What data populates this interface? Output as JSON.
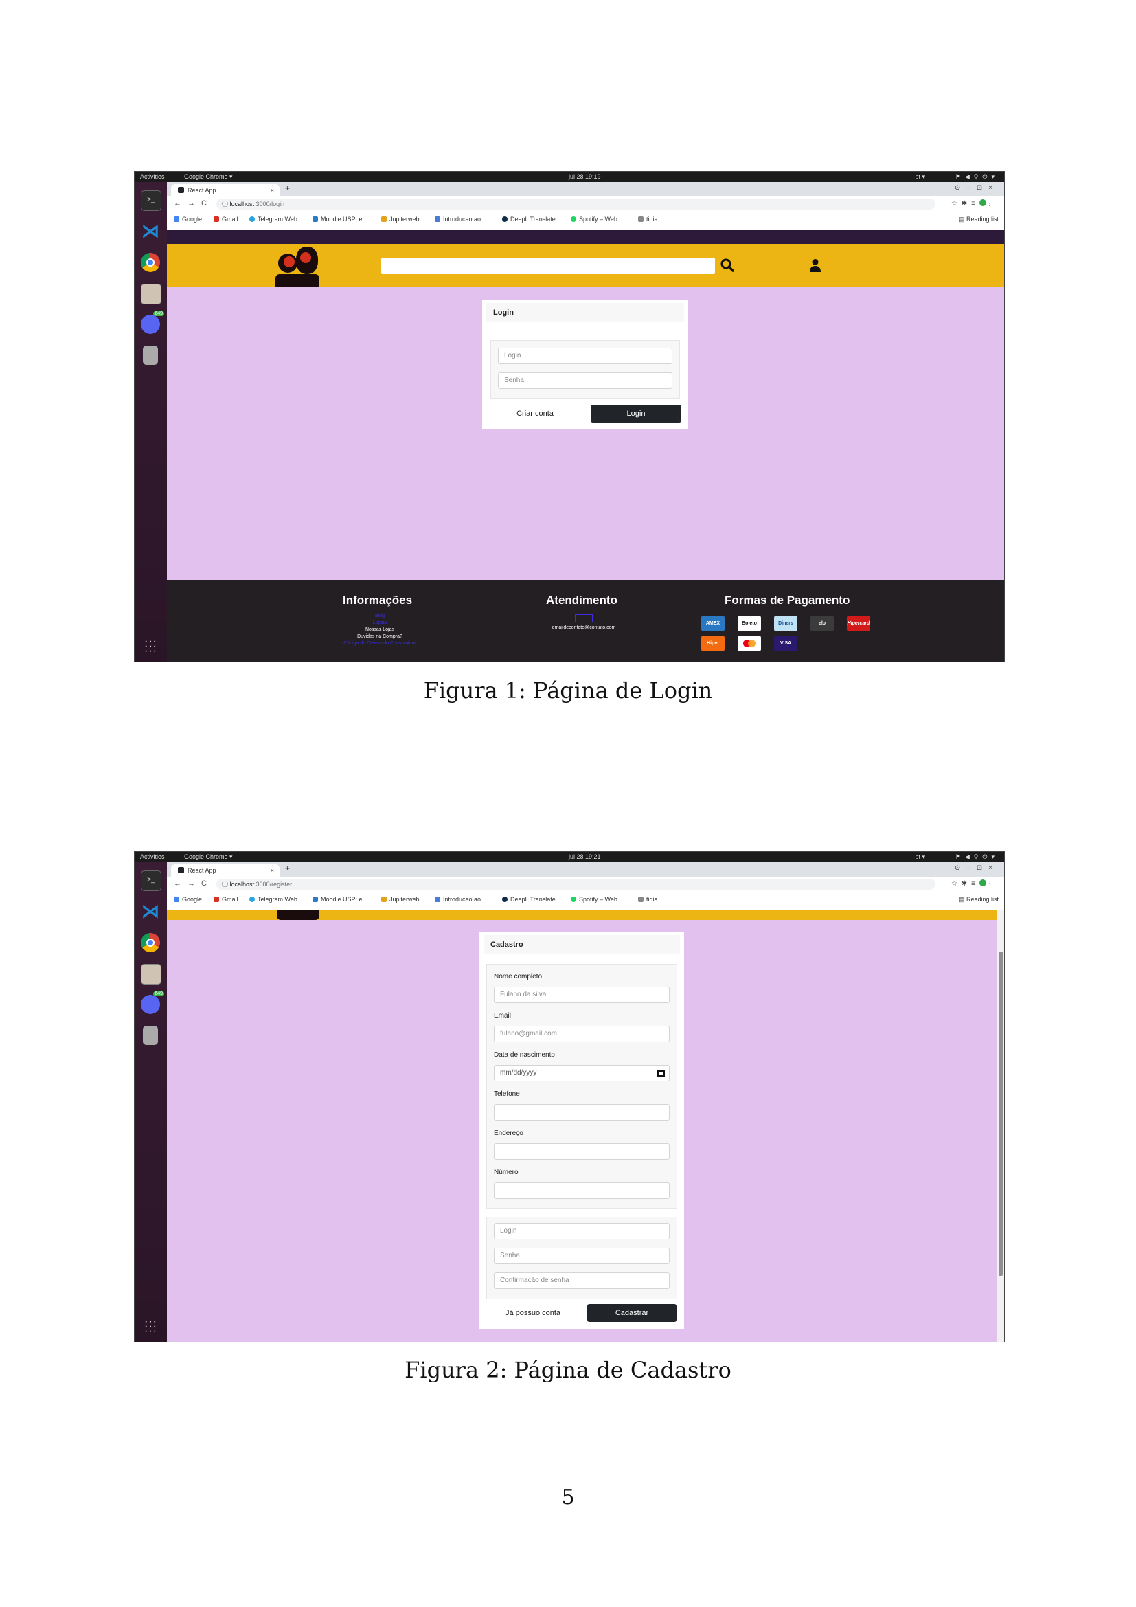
{
  "figure1": {
    "ubuntu": {
      "activities": "Activities",
      "app": "Google Chrome ▾",
      "clock": "jul 28  19:19",
      "lang": "pt ▾",
      "badge": "649"
    },
    "browser": {
      "tab_title": "React App",
      "url_host": "localhost",
      "url_path": ":3000/login",
      "bookmarks": [
        "Google",
        "Gmail",
        "Telegram Web",
        "Moodle USP: e...",
        "Jupiterweb",
        "Introducao ao...",
        "DeepL Translate",
        "Spotify – Web...",
        "tidia"
      ],
      "reading_list": "Reading list"
    },
    "login_card": {
      "title": "Login",
      "login_placeholder": "Login",
      "password_placeholder": "Senha",
      "create_account": "Criar conta",
      "submit": "Login"
    },
    "footer": {
      "info_title": "Informações",
      "info_links": [
        "Blog",
        "Lojista",
        "Nossas Lojas",
        "Duvidas na Compra?",
        "Código de Defesa do Consumidor"
      ],
      "service_title": "Atendimento",
      "service_email": "emaildecontato@contato.com",
      "payment_title": "Formas de Pagamento",
      "payment_methods": [
        "AMEX",
        "Boleto",
        "Diners",
        "elo",
        "Hipercard",
        "Hiper",
        "Mastercard",
        "VISA"
      ]
    },
    "caption": "Figura 1: Página de Login"
  },
  "figure2": {
    "ubuntu": {
      "activities": "Activities",
      "app": "Google Chrome ▾",
      "clock": "jul 28  19:21",
      "lang": "pt ▾",
      "badge": "649"
    },
    "browser": {
      "tab_title": "React App",
      "url_host": "localhost",
      "url_path": ":3000/register",
      "bookmarks": [
        "Google",
        "Gmail",
        "Telegram Web",
        "Moodle USP: e...",
        "Jupiterweb",
        "Introducao ao...",
        "DeepL Translate",
        "Spotify – Web...",
        "tidia"
      ],
      "reading_list": "Reading list"
    },
    "register_card": {
      "title": "Cadastro",
      "full_name_label": "Nome completo",
      "full_name_placeholder": "Fulano da silva",
      "email_label": "Email",
      "email_placeholder": "fulano@gmail.com",
      "birth_label": "Data de nascimento",
      "birth_placeholder": "mm/dd/yyyy",
      "phone_label": "Telefone",
      "address_label": "Endereço",
      "number_label": "Número",
      "login_placeholder": "Login",
      "password_placeholder": "Senha",
      "confirm_placeholder": "Confirmação de senha",
      "have_account": "Já possuo conta",
      "submit": "Cadastrar"
    },
    "caption": "Figura 2: Página de Cadastro"
  },
  "page_number": "5",
  "colors": {
    "header_yellow": "#edb514",
    "page_lilac": "#e3c1ef",
    "footer_dark": "#231f22",
    "nav_purple": "#2d1a3a",
    "link_blue": "#3b2ee0"
  }
}
